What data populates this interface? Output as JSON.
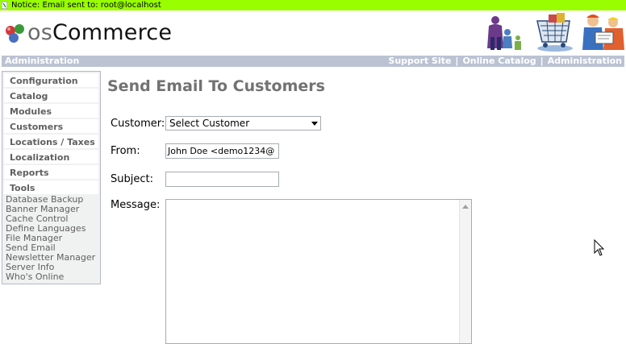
{
  "notice": {
    "text": "Notice: Email sent to: root@localhost",
    "color": "#99ff00"
  },
  "logo": {
    "prefix": "os",
    "name": "Commerce"
  },
  "adminbar": {
    "left": "Administration",
    "links": [
      "Support Site",
      "Online Catalog",
      "Administration"
    ],
    "separator": "|"
  },
  "sidebar": {
    "items": [
      {
        "label": "Configuration"
      },
      {
        "label": "Catalog"
      },
      {
        "label": "Modules"
      },
      {
        "label": "Customers"
      },
      {
        "label": "Locations / Taxes"
      },
      {
        "label": "Localization"
      },
      {
        "label": "Reports"
      },
      {
        "label": "Tools"
      }
    ],
    "tools": [
      "Database Backup",
      "Banner Manager",
      "Cache Control",
      "Define Languages",
      "File Manager",
      "Send Email",
      "Newsletter Manager",
      "Server Info",
      "Who's Online"
    ]
  },
  "page": {
    "title": "Send Email To Customers",
    "customer_label": "Customer:",
    "customer_value": "Select Customer",
    "from_label": "From:",
    "from_value": "John Doe <demo1234@",
    "subject_label": "Subject:",
    "subject_value": "",
    "message_label": "Message:",
    "message_value": ""
  },
  "colors": {
    "adminbar_bg": "#bbc3d3",
    "title_color": "#727272",
    "menu_text": "#616060"
  }
}
